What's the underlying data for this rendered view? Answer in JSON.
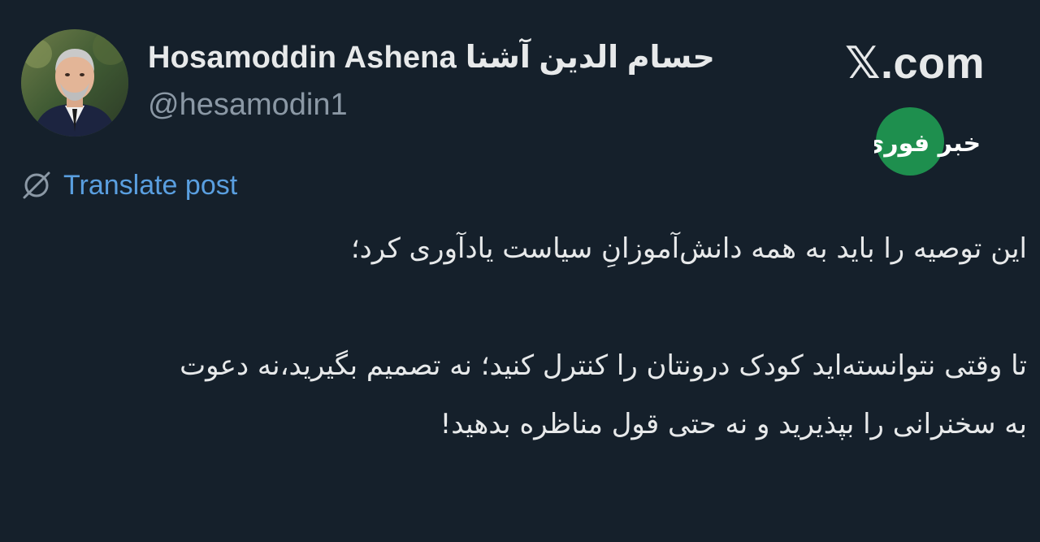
{
  "author": {
    "display_name": "Hosamoddin Ashena حسام الدین آشنا",
    "handle": "@hesamodin1"
  },
  "site_logo": "𝕏.com",
  "news_badge": "خبر فوری",
  "translate": {
    "label": "Translate post",
    "icon": "globe-icon"
  },
  "post": {
    "paragraphs": [
      "این توصیه را باید به همه دانش‌آموزانِ سیاست یادآوری کرد؛",
      "تا وقتی نتوانسته‌اید کودک درونتان را کنترل کنید؛ نه تصمیم بگیرید،نه دعوت به سخنرانی را بپذیرید و نه حتی قول مناظره بدهید!"
    ]
  },
  "colors": {
    "background": "#15202b",
    "text": "#e7e9ea",
    "secondary_text": "#8b98a5",
    "link": "#5a9fe0",
    "badge_green": "#1e8f4e"
  }
}
